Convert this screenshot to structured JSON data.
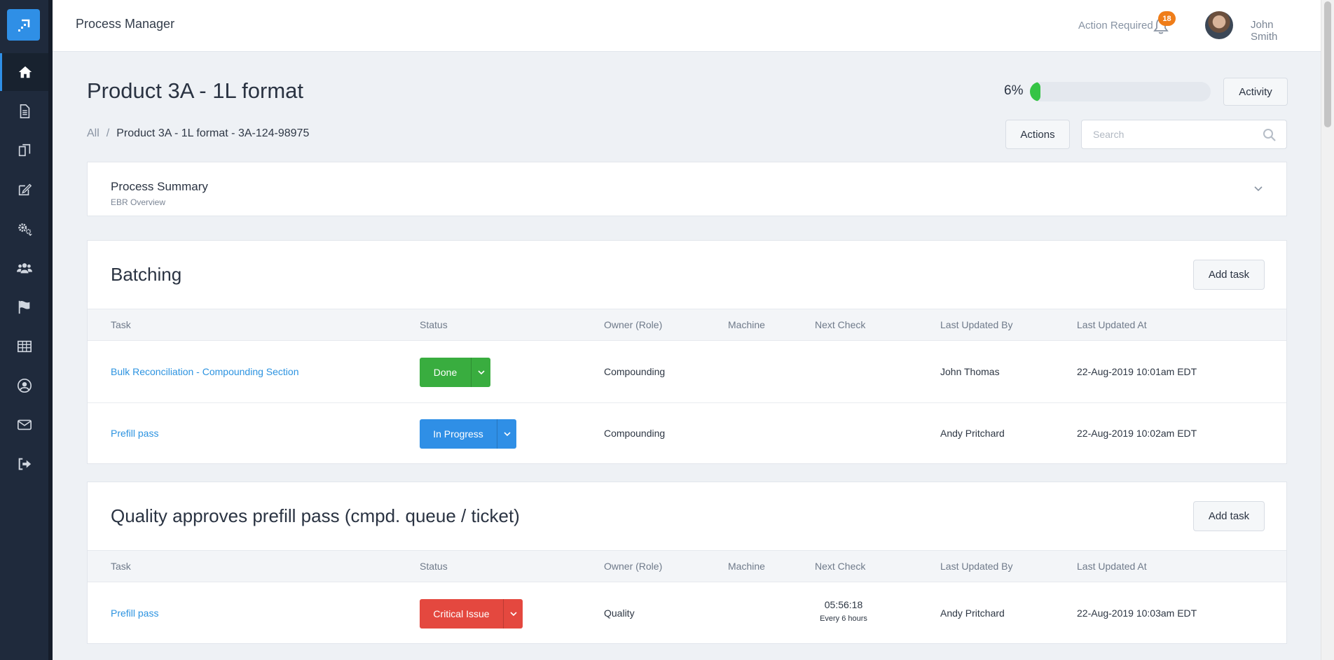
{
  "header": {
    "app_title": "Process Manager",
    "action_required_label": "Action Required",
    "notification_count": "18",
    "user_name": "John Smith"
  },
  "page": {
    "title": "Product 3A - 1L format",
    "breadcrumb": [
      "All",
      "/",
      "Product 3A - 1L format - 3A-124-98975"
    ],
    "progress_label": "6%",
    "progress_value": 0.06,
    "activity_label": "Activity",
    "actions_label": "Actions",
    "search_placeholder": "Search"
  },
  "summary": {
    "title": "Process Summary",
    "subtitle": "EBR Overview"
  },
  "columns": [
    "Task",
    "Status",
    "Owner (Role)",
    "Machine",
    "Next Check",
    "Last Updated By",
    "Last Updated At"
  ],
  "sections": [
    {
      "title": "Batching",
      "add_label": "Add task",
      "rows": [
        {
          "task": "Bulk Reconciliation - Compounding Section",
          "status": "Done",
          "owner": "Compounding",
          "machine": "",
          "next_check": "",
          "next_check_freq": "",
          "updated_by": "John Thomas",
          "updated_at": "22-Aug-2019 10:01am EDT"
        },
        {
          "task": "Prefill pass",
          "status": "In Progress",
          "owner": "Compounding",
          "machine": "",
          "next_check": "",
          "next_check_freq": "",
          "updated_by": "Andy Pritchard",
          "updated_at": "22-Aug-2019 10:02am EDT"
        }
      ]
    },
    {
      "title": "Quality approves prefill pass (cmpd. queue / ticket)",
      "add_label": "Add task",
      "rows": [
        {
          "task": "Prefill pass",
          "status": "Critical Issue",
          "owner": "Quality",
          "machine": "",
          "next_check": "05:56:18",
          "next_check_freq": "Every 6 hours",
          "updated_by": "Andy Pritchard",
          "updated_at": "22-Aug-2019 10:03am EDT"
        }
      ]
    }
  ],
  "colors": {
    "sidebar": "#1f2a3c",
    "accent": "#2f8fe6",
    "done": "#39ad3f",
    "in_progress": "#2f8fe6",
    "critical": "#e4483f",
    "badge": "#ef7d19",
    "progress": "#35c445"
  },
  "icons": {
    "sidebar": [
      "home-icon",
      "document-icon",
      "copy-icon",
      "edit-icon",
      "gears-icon",
      "users-icon",
      "flag-icon",
      "table-icon",
      "user-circle-icon",
      "envelope-icon",
      "sign-out-icon"
    ]
  }
}
